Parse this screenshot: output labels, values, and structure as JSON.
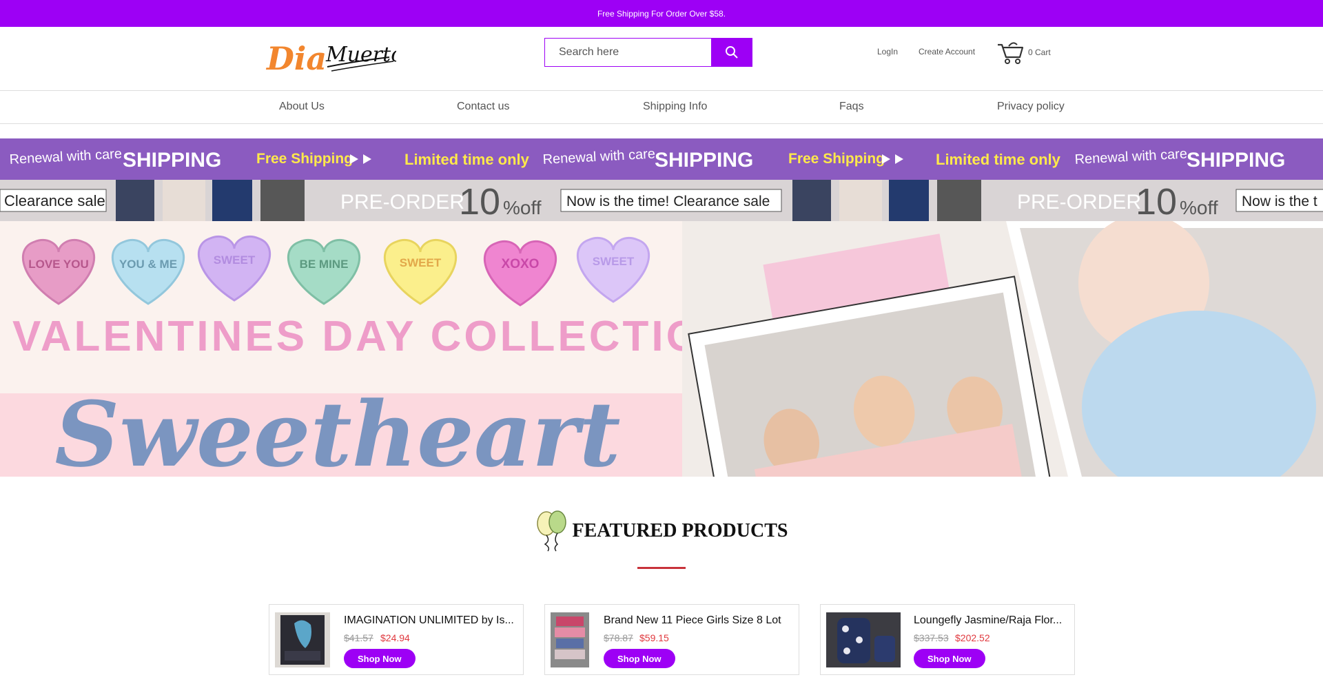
{
  "topbar": {
    "text": "Free Shipping For Order Over $58."
  },
  "logo": {
    "alt": "Dia Muertos"
  },
  "search": {
    "placeholder": "Search here"
  },
  "header": {
    "login": "LogIn",
    "create_account": "Create Account",
    "cart": "0 Cart"
  },
  "nav": [
    "About Us",
    "Contact us",
    "Shipping Info",
    "Faqs",
    "Privacy policy"
  ],
  "promo_strip_1": [
    "Renewal with care",
    "SHIPPING",
    "Free Shipping",
    "Limited time only",
    "Renewal with care",
    "SHIPPING",
    "Free Shipping",
    "Limited time only",
    "Renewal with care",
    "SHIPPING"
  ],
  "promo_strip_2": [
    "Clearance sale",
    "PRE-ORDER",
    "10",
    "%off",
    "Now is the time! Clearance sale",
    "PRE-ORDER",
    "10",
    "%off",
    "Now is the t"
  ],
  "hero": {
    "hearts": [
      "LOVE YOU",
      "YOU & ME",
      "SWEET",
      "BE MINE",
      "SWEET",
      "XOXO",
      "SWEET"
    ],
    "collection": "VALENTINES DAY COLLECTION",
    "headline": "Sweetheart"
  },
  "featured": {
    "title": "FEATURED PRODUCTS"
  },
  "products": [
    {
      "name": "IMAGINATION UNLIMITED by Is...",
      "old_price": "$41.57",
      "price": "$24.94",
      "button": "Shop Now"
    },
    {
      "name": "Brand New 11 Piece Girls Size 8 Lot",
      "old_price": "$78.87",
      "price": "$59.15",
      "button": "Shop Now"
    },
    {
      "name": "Loungefly Jasmine/Raja Flor...",
      "old_price": "$337.53",
      "price": "$202.52",
      "button": "Shop Now"
    }
  ],
  "colors": {
    "brand": "#9d00f5",
    "sale": "#e0383e",
    "accent_line": "#c8323a"
  }
}
